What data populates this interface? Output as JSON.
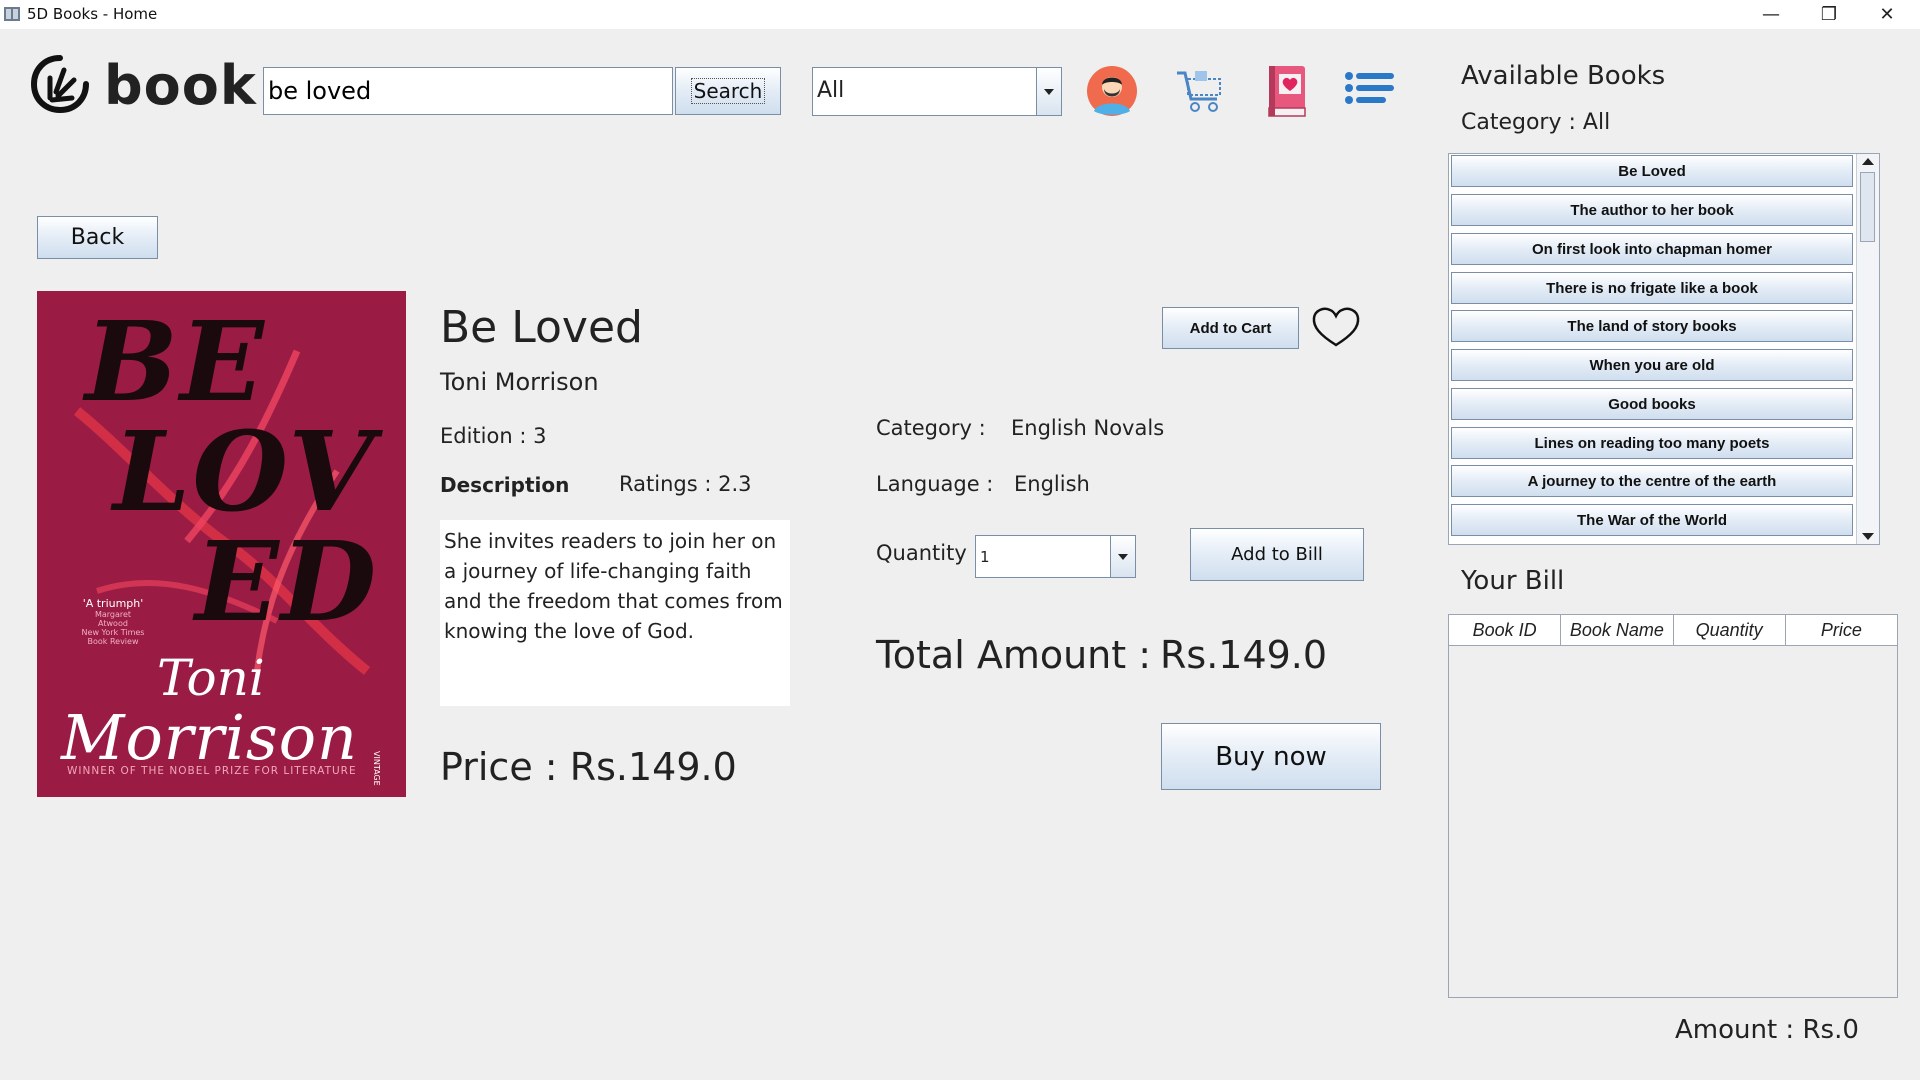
{
  "window": {
    "title": "5D Books - Home",
    "controls": {
      "minimize": "—",
      "restore": "❐",
      "close": "✕"
    }
  },
  "header": {
    "logo_text": "book",
    "search": {
      "value": "be loved",
      "button": "Search"
    },
    "category_select": {
      "value": "All"
    },
    "icons": [
      "profile-icon",
      "cart-icon",
      "wishlist-book-icon",
      "menu-icon"
    ]
  },
  "nav": {
    "back": "Back"
  },
  "book": {
    "title": "Be Loved",
    "author": "Toni Morrison",
    "edition_label": "Edition :",
    "edition": "3",
    "description_label": "Description",
    "ratings_label": "Ratings :",
    "ratings": "2.3",
    "description": "She invites readers to join her on a journey of life-changing faith and the freedom that comes from knowing the love of God.",
    "price_label": "Price :",
    "price": "Rs.149.0",
    "category_label": "Category :",
    "category": "English Novals",
    "language_label": "Language :",
    "language": "English",
    "cover": {
      "title_lines": [
        "BE",
        "LOV",
        "ED"
      ],
      "quote": "'A triumph'",
      "quote_source": [
        "Margaret Atwood",
        "New York Times",
        "Book Review"
      ],
      "author_script": [
        "Toni",
        "Morrison"
      ],
      "footer": "WINNER OF THE NOBEL PRIZE FOR LITERATURE",
      "publisher": "VINTAGE"
    }
  },
  "actions": {
    "add_to_cart": "Add to Cart",
    "quantity_label": "Quantity",
    "quantity_value": "1",
    "add_to_bill": "Add to Bill",
    "total_label": "Total Amount :",
    "total": "Rs.149.0",
    "buy_now": "Buy now"
  },
  "sidebar": {
    "heading": "Available Books",
    "category_label": "Category :",
    "category_value": "All",
    "books": [
      "Be Loved",
      "The author to her book",
      "On first look into chapman homer",
      "There is no frigate like a book",
      "The land of story books",
      "When you are old",
      "Good books",
      "Lines on reading too many poets",
      "A journey to the centre of the earth",
      "The War of the World"
    ],
    "bill_heading": "Your Bill",
    "bill_columns": [
      "Book ID",
      "Book Name",
      "Quantity",
      "Price"
    ],
    "amount_label": "Amount :",
    "amount": "Rs.0"
  },
  "colors": {
    "cover_bg": "#9a1c45",
    "button_border": "#7a8ea8",
    "heart_fill": "#e0245e"
  }
}
